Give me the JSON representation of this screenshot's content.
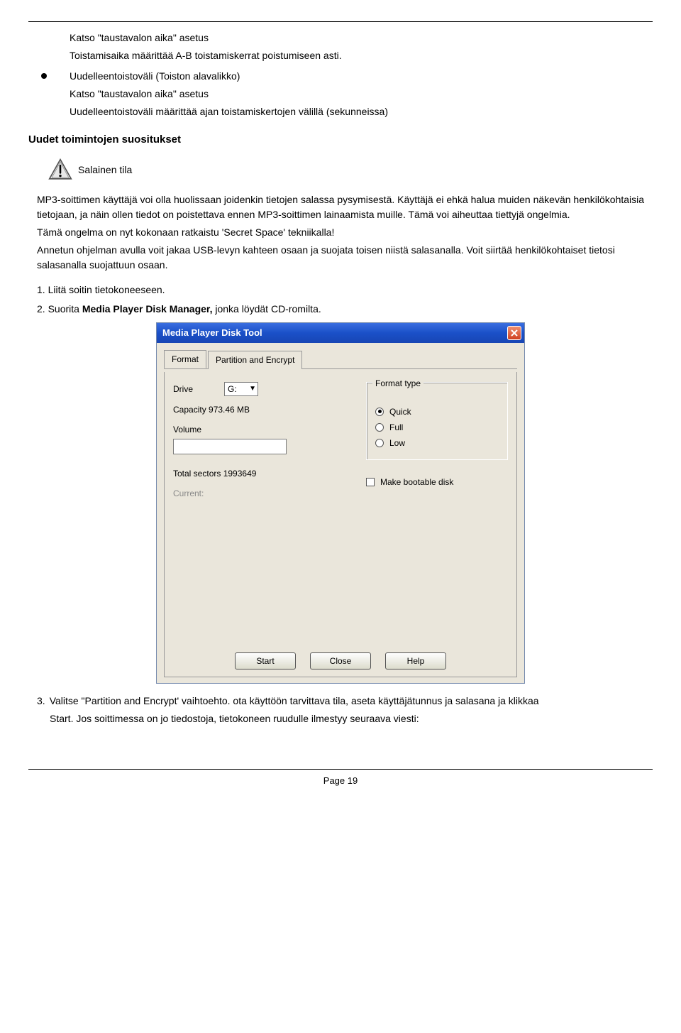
{
  "top": {
    "line1": "Katso \"taustavalon aika\" asetus",
    "line2": "Toistamisaika määrittää A-B toistamiskerrat poistumiseen asti.",
    "bullet_title": "Uudelleentoistoväli (Toiston alavalikko)",
    "line3": "Katso \"taustavalon aika\" asetus",
    "line4": "Uudelleentoistoväli määrittää ajan toistamiskertojen välillä (sekunneissa)"
  },
  "section_heading": "Uudet toimintojen suositukset",
  "caution_label": "Salainen tila",
  "para1": "MP3-soittimen käyttäjä voi olla huolissaan joidenkin tietojen salassa pysymisestä. Käyttäjä ei ehkä halua muiden näkevän henkilökohtaisia tietojaan, ja näin ollen tiedot on poistettava ennen MP3-soittimen lainaamista muille. Tämä voi aiheuttaa tiettyjä ongelmia.",
  "para2": "Tämä ongelma on nyt kokonaan ratkaistu 'Secret Space' tekniikalla!",
  "para3": "Annetun ohjelman avulla voit jakaa USB-levyn kahteen osaan ja suojata toisen niistä salasanalla. Voit siirtää henkilökohtaiset tietosi salasanalla suojattuun osaan.",
  "step1": "1. Liitä soitin tietokoneeseen.",
  "step2_pre": "2. Suorita ",
  "step2_bold": "Media Player Disk Manager,",
  "step2_post": " jonka löydät CD-romilta.",
  "dialog": {
    "title": "Media Player Disk Tool",
    "tabs": {
      "format": "Format",
      "partition": "Partition and Encrypt"
    },
    "drive_label": "Drive",
    "drive_value": "G:",
    "capacity": "Capacity 973.46 MB",
    "volume_label": "Volume",
    "volume_value": "",
    "total_sectors": "Total sectors 1993649",
    "current": "Current:",
    "format_type_legend": "Format type",
    "radio_quick": "Quick",
    "radio_full": "Full",
    "radio_low": "Low",
    "check_bootable": "Make bootable disk",
    "btn_start": "Start",
    "btn_close": "Close",
    "btn_help": "Help"
  },
  "step3_num": "3.",
  "step3_a": "Valitse \"Partition and Encrypt' vaihtoehto. ota käyttöön tarvittava tila, aseta käyttäjätunnus ja salasana ja klikkaa",
  "step3_b": "Start. Jos soittimessa on jo tiedostoja, tietokoneen ruudulle ilmestyy seuraava viesti:",
  "footer": "Page 19"
}
